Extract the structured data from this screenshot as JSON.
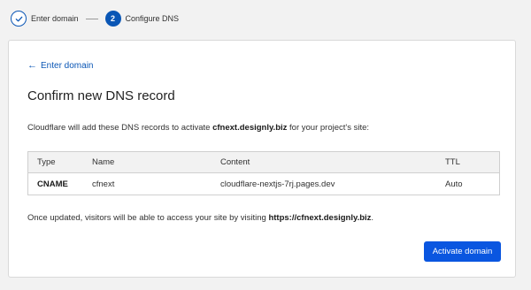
{
  "stepper": {
    "steps": [
      {
        "label": "Enter domain",
        "state": "complete",
        "icon": "check-icon"
      },
      {
        "number": "2",
        "label": "Configure DNS",
        "state": "current"
      }
    ]
  },
  "card": {
    "back_link": "Enter domain",
    "back_icon": "arrow-left-icon",
    "title": "Confirm new DNS record",
    "intro_prefix": "Cloudflare will add these DNS records to activate ",
    "intro_domain": "cfnext.designly.biz",
    "intro_suffix": " for your project's site:",
    "table": {
      "headers": [
        "Type",
        "Name",
        "Content",
        "TTL"
      ],
      "rows": [
        {
          "type": "CNAME",
          "name": "cfnext",
          "content": "cloudflare-nextjs-7rj.pages.dev",
          "ttl": "Auto"
        }
      ]
    },
    "note_prefix": "Once updated, visitors will be able to access your site by visiting ",
    "note_url": "https://cfnext.designly.biz",
    "note_suffix": ".",
    "activate_button": "Activate domain"
  },
  "colors": {
    "accent": "#0a56b5",
    "button": "#0a56e0",
    "background": "#f2f2f2",
    "table_header": "#f2f2f2"
  }
}
